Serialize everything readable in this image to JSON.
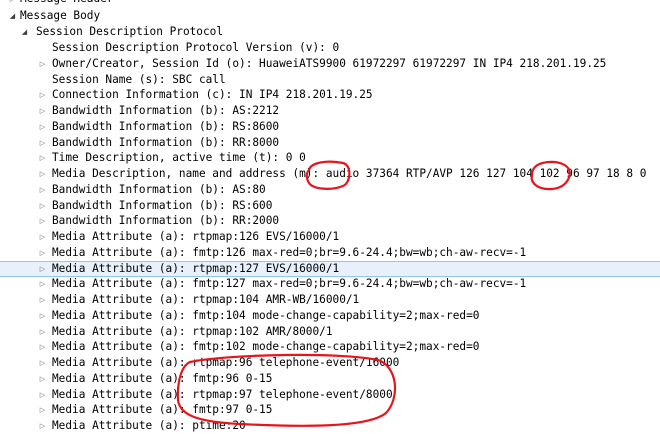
{
  "tree": {
    "partial_row": "Message Header",
    "message_body": "Message Body",
    "sdp": "Session Description Protocol",
    "fields": [
      "Session Description Protocol Version (v): 0",
      "Owner/Creator, Session Id (o): HuaweiATS9900 61972297 61972297 IN IP4 218.201.19.25",
      "Session Name (s): SBC call",
      "Connection Information (c): IN IP4 218.201.19.25",
      "Bandwidth Information (b): AS:2212",
      "Bandwidth Information (b): RS:8600",
      "Bandwidth Information (b): RR:8000",
      "Time Description, active time (t): 0 0",
      "Media Description, name and address (m): audio 37364 RTP/AVP 126 127 104 102 96 97 18 8 0",
      "Bandwidth Information (b): AS:80",
      "Bandwidth Information (b): RS:600",
      "Bandwidth Information (b): RR:2000",
      "Media Attribute (a): rtpmap:126 EVS/16000/1",
      "Media Attribute (a): fmtp:126 max-red=0;br=9.6-24.4;bw=wb;ch-aw-recv=-1",
      "Media Attribute (a): rtpmap:127 EVS/16000/1",
      "Media Attribute (a): fmtp:127 max-red=0;br=9.6-24.4;bw=wb;ch-aw-recv=-1",
      "Media Attribute (a): rtpmap:104 AMR-WB/16000/1",
      "Media Attribute (a): fmtp:104 mode-change-capability=2;max-red=0",
      "Media Attribute (a): rtpmap:102 AMR/8000/1",
      "Media Attribute (a): fmtp:102 mode-change-capability=2;max-red=0",
      "Media Attribute (a): rtpmap:96 telephone-event/16000",
      "Media Attribute (a): fmtp:96 0-15",
      "Media Attribute (a): rtpmap:97 telephone-event/8000",
      "Media Attribute (a): fmtp:97 0-15",
      "Media Attribute (a): ptime:20"
    ]
  },
  "glyphs": {
    "expanded": "◢",
    "collapsed": "▷"
  },
  "colors": {
    "selection_background": "#e8f1fb",
    "selection_border": "#99c4ea",
    "annotation_red": "#e8141c"
  }
}
